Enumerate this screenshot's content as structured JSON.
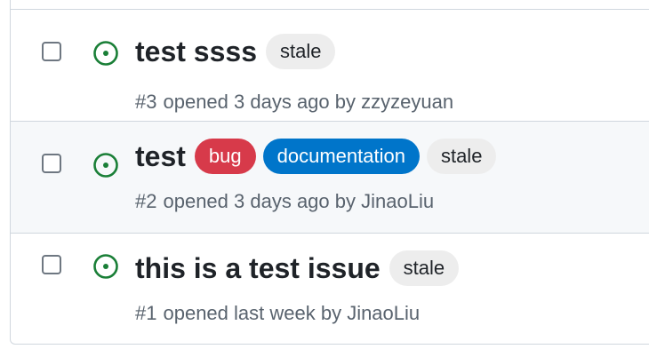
{
  "colors": {
    "open_icon": "#1a7f37",
    "label_stale_bg": "#ededed",
    "label_stale_fg": "#1f2328",
    "label_bug_bg": "#d73a4a",
    "label_documentation_bg": "#0075ca",
    "label_white_fg": "#ffffff"
  },
  "issues": [
    {
      "title": "test ssss",
      "status_icon": "issue-opened-icon",
      "labels": [
        {
          "text": "stale"
        }
      ],
      "number": "#3",
      "opened_text": "opened 3 days ago by",
      "author": "zzyzeyuan"
    },
    {
      "title": "test",
      "status_icon": "issue-opened-icon",
      "labels": [
        {
          "text": "bug"
        },
        {
          "text": "documentation"
        },
        {
          "text": "stale"
        }
      ],
      "number": "#2",
      "opened_text": "opened 3 days ago by",
      "author": "JinaoLiu"
    },
    {
      "title": "this is a test issue",
      "status_icon": "issue-opened-icon",
      "labels": [
        {
          "text": "stale"
        }
      ],
      "number": "#1",
      "opened_text": "opened last week by",
      "author": "JinaoLiu"
    }
  ]
}
